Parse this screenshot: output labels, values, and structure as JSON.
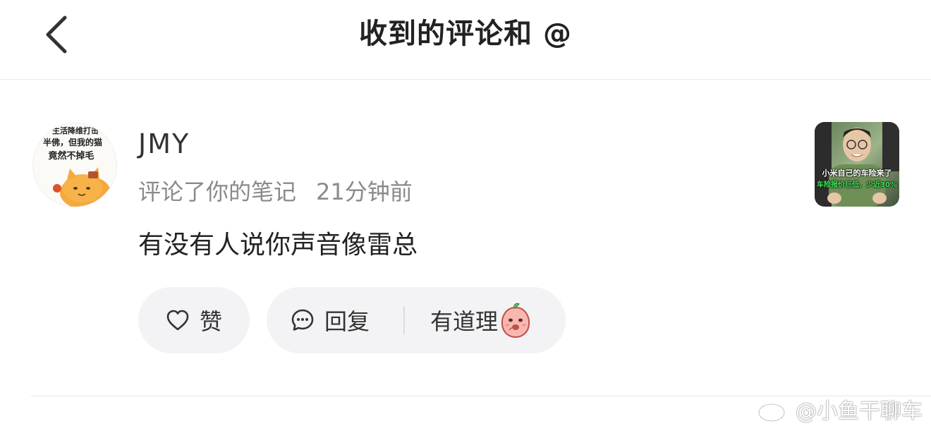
{
  "header": {
    "title": "收到的评论和 @"
  },
  "comment": {
    "avatar": {
      "caption_line1": "生活降维打击",
      "caption_line2": "半佛，但我的猫",
      "caption_line3": "竟然不掉毛"
    },
    "username": "JMY",
    "action_text": "评论了你的笔记",
    "time": "21分钟前",
    "text": "有没有人说你声音像雷总",
    "thumbnail": {
      "caption_line1": "小米自己的车险来了",
      "caption_line2": "车险报价巨低，少近30%"
    }
  },
  "actions": {
    "like_label": "赞",
    "reply_label": "回复",
    "quick_reply_label": "有道理"
  },
  "watermark": {
    "text": "@小鱼干聊车"
  },
  "colors": {
    "background": "#ffffff",
    "button_bg": "#f3f3f5",
    "secondary_text": "#8a8a8a",
    "primary_text": "#222222",
    "thumbnail_caption_green": "#3ee65a"
  }
}
